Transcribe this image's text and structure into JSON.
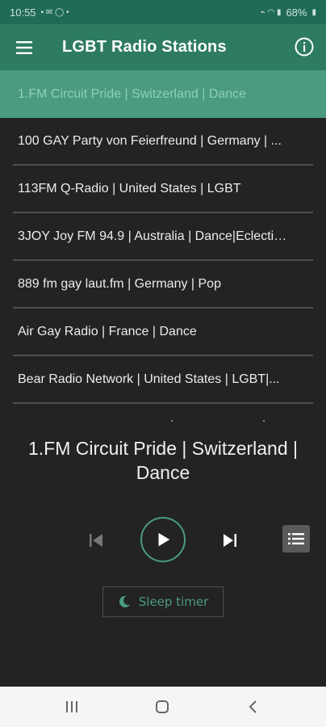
{
  "status_bar": {
    "time": "10:55",
    "battery": "68%"
  },
  "app_bar": {
    "title": "LGBT Radio Stations"
  },
  "stations": [
    {
      "label": "1.FM Circuit Pride | Switzerland | Dance",
      "active": true
    },
    {
      "label": "100 GAY Party von Feierfreund | Germany | ..."
    },
    {
      "label": "113FM Q-Radio | United States | LGBT"
    },
    {
      "label": "3JOY Joy FM 94.9 | Australia | Dance|Eclectic|..."
    },
    {
      "label": "889 fm gay laut.fm | Germany | Pop"
    },
    {
      "label": "Air Gay Radio | France | Dance"
    },
    {
      "label": "Bear Radio Network | United States | LGBT|..."
    }
  ],
  "player": {
    "now_playing": "1.FM Circuit Pride | Switzerland | Dance",
    "sleep_timer_label": "Sleep timer"
  },
  "colors": {
    "status_bar": "#1f6b55",
    "app_bar": "#2e7b63",
    "accent": "#4a9b80",
    "background": "#232323"
  },
  "icons": {
    "menu": "hamburger-icon",
    "info": "info-icon",
    "prev": "skip-previous-icon",
    "play": "play-icon",
    "next": "skip-next-icon",
    "playlist": "playlist-icon",
    "sleep": "moon-icon"
  }
}
